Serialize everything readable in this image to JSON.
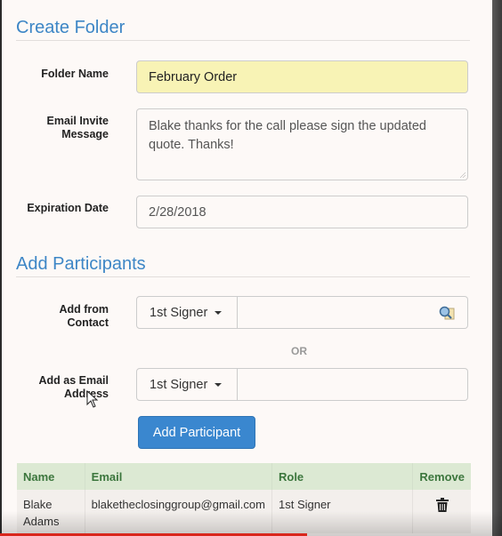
{
  "create_folder": {
    "title": "Create Folder",
    "folder_name": {
      "label": "Folder Name",
      "value": "February Order"
    },
    "email_invite": {
      "label_line1": "Email Invite",
      "label_line2": "Message",
      "value_line1": "Blake thanks for the call please sign the updated",
      "value_line2": "quote. Thanks!"
    },
    "expiration": {
      "label": "Expiration Date",
      "value": "2/28/2018"
    }
  },
  "add_participants": {
    "title": "Add Participants",
    "from_contact": {
      "label_line1": "Add from",
      "label_line2": "Contact",
      "role": "1st Signer",
      "value": "",
      "icon": "contact-search-icon"
    },
    "separator": "OR",
    "as_email": {
      "label_line1": "Add as Email",
      "label_line2": "Address",
      "role": "1st Signer",
      "value": ""
    },
    "add_button": "Add Participant"
  },
  "participants_table": {
    "columns": [
      "Name",
      "Email",
      "Role",
      "Remove"
    ],
    "rows": [
      {
        "name_line1": "Blake",
        "name_line2": "Adams",
        "email": "blaketheclosinggroup@gmail.com",
        "role": "1st Signer",
        "remove_icon": "trash-icon"
      }
    ]
  },
  "colors": {
    "accent": "#3d86c6",
    "button": "#3a87cf",
    "highlight": "#f8f3b5",
    "table_header": "#dce9d3",
    "table_header_text": "#3c763d"
  }
}
